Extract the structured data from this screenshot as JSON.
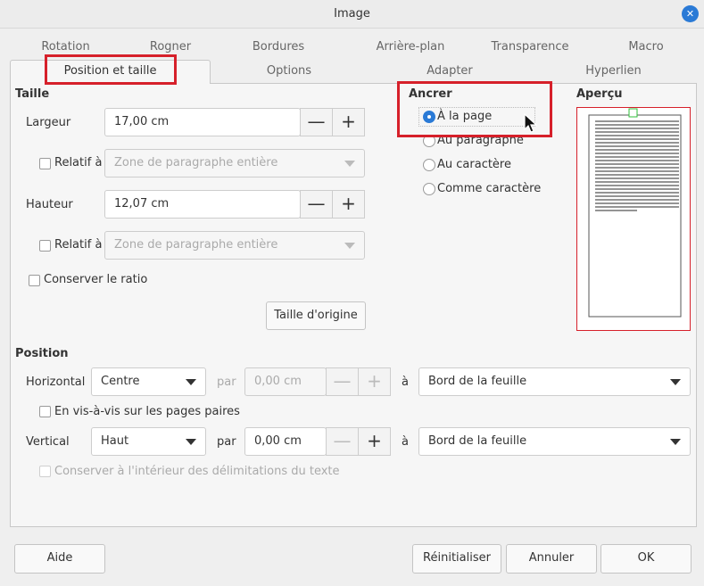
{
  "window": {
    "title": "Image",
    "close_glyph": "✕"
  },
  "tabs_row1": [
    "Rotation",
    "Rogner",
    "Bordures",
    "Arrière-plan",
    "Transparence",
    "Macro"
  ],
  "tabs_row2": [
    "Position et taille",
    "Options",
    "Adapter",
    "Hyperlien"
  ],
  "size": {
    "heading": "Taille",
    "width_label": "Largeur",
    "width_value": "17,00 cm",
    "height_label": "Hauteur",
    "height_value": "12,07 cm",
    "relative_label": "Relatif à",
    "relative_option": "Zone de paragraphe entière",
    "keep_ratio_label": "Conserver le ratio",
    "original_size_button": "Taille d'origine",
    "minus": "—",
    "plus": "+"
  },
  "anchor": {
    "heading": "Ancrer",
    "options": [
      "À la page",
      "Au paragraphe",
      "Au caractère",
      "Comme caractère"
    ],
    "selected": "À la page"
  },
  "preview": {
    "heading": "Aperçu"
  },
  "position": {
    "heading": "Position",
    "horizontal_label": "Horizontal",
    "horizontal_value": "Centre",
    "by_label": "par",
    "horizontal_by_value": "0,00 cm",
    "to_label": "à",
    "horizontal_to_value": "Bord de la feuille",
    "mirror_label": "En vis-à-vis sur les pages paires",
    "vertical_label": "Vertical",
    "vertical_value": "Haut",
    "vertical_by_value": "0,00 cm",
    "vertical_to_value": "Bord de la feuille",
    "keep_inside_label": "Conserver à l'intérieur des délimitations du texte"
  },
  "footer": {
    "help": "Aide",
    "reset": "Réinitialiser",
    "cancel": "Annuler",
    "ok": "OK"
  }
}
